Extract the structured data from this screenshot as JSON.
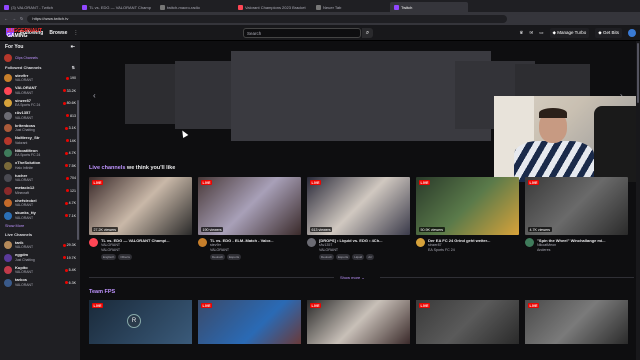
{
  "browser": {
    "tabs": [
      {
        "label": "(3) VALORANT - Twitch",
        "icon": "twitch-icon",
        "active": false
      },
      {
        "label": "TL vs. EDG — VALORANT Champ",
        "icon": "twitch-icon",
        "active": false
      },
      {
        "label": "twitch-macro-radio",
        "icon": "page-icon",
        "active": false
      },
      {
        "label": "Valorant Champions 2023 Bracket",
        "icon": "valorant-icon",
        "active": false
      },
      {
        "label": "Neuer Tab",
        "icon": "page-icon",
        "active": false
      },
      {
        "label": "Twitch",
        "icon": "twitch-icon",
        "active": true
      }
    ],
    "url": "https://www.twitch.tv"
  },
  "topnav": {
    "following": "Following",
    "browse": "Browse",
    "search_placeholder": "Search",
    "manage_turbo": "Manage Turbo",
    "get_bits": "Get Bits"
  },
  "overlay": {
    "line1": "JUGGERNAUT",
    "line2": "GAMING"
  },
  "sidebar": {
    "for_you": "For You",
    "recommended": "Clips Channels",
    "followed_title": "Followed Channels",
    "channels": [
      {
        "name": "stev9rr",
        "game": "VALORANT",
        "viewers": "190",
        "color": "#c77f2b"
      },
      {
        "name": "VALORANT",
        "game": "VALORANT",
        "viewers": "33.2K",
        "color": "#ff4655"
      },
      {
        "name": "sinzer87",
        "game": "EA Sports FC 24",
        "viewers": "80.6K",
        "color": "#d6a23b"
      },
      {
        "name": "rAv1357",
        "game": "VALORANT",
        "viewers": "813",
        "color": "#6b6b73"
      },
      {
        "name": "kritenboss",
        "game": "Just Chatting",
        "viewers": "3.1K",
        "color": "#aa5a3a"
      },
      {
        "name": "NoMercy_Str",
        "game": "Valorant",
        "viewers": "14K",
        "color": "#b5372b"
      },
      {
        "name": "NikoatMeon",
        "game": "EA Sports FC 24",
        "viewers": "4.7K",
        "color": "#3f7b5b"
      },
      {
        "name": "xTheSolution",
        "game": "Halo Infinite",
        "viewers": "7.5K",
        "color": "#7a6a3a"
      },
      {
        "name": "tucher",
        "game": "VALORANT",
        "viewers": "704",
        "color": "#4a4a52"
      },
      {
        "name": "metacix12",
        "game": "Minecraft",
        "viewers": "121",
        "color": "#8a2a2a"
      },
      {
        "name": "chefstrobel",
        "game": "VALORANT",
        "viewers": "4.7K",
        "color": "#c46a2a"
      },
      {
        "name": "skunks_tty",
        "game": "VALORANT",
        "viewers": "7.1K",
        "color": "#2b6fb5"
      }
    ],
    "show_more": "Show More",
    "live_title": "Live Channels",
    "live": [
      {
        "name": "tarik",
        "game": "VALORANT",
        "viewers": "29.3K",
        "color": "#b58a5a"
      },
      {
        "name": "eggdm",
        "game": "Just Chatting",
        "viewers": "19.7K",
        "color": "#5a3a9a"
      },
      {
        "name": "Kupito",
        "game": "VALORANT",
        "viewers": "5.4K",
        "color": "#c13a4a"
      },
      {
        "name": "tarkos",
        "game": "VALORANT",
        "viewers": "6.3K",
        "color": "#3a5a8a"
      }
    ]
  },
  "main": {
    "live_section_prefix": "Live channels",
    "live_section_suffix": "we think you'll like",
    "cards": [
      {
        "title": "TL vs. EDG — VALORANT Champi...",
        "channel": "VALORANT",
        "game": "VALORANT",
        "viewers": "27.2K viewers",
        "tags": [
          "Englisch",
          "Olberts"
        ],
        "thumb": "linear-gradient(135deg,#3a2a2a,#c9b8a8 50%,#2a2a2a)",
        "avatar": "#ff4655"
      },
      {
        "title": "TL vs. EDG - ELM..Match - Valor...",
        "channel": "stev9rr",
        "game": "VALORANT",
        "viewers": "190 viewers",
        "tags": [
          "Deutsch",
          "Esports"
        ],
        "thumb": "linear-gradient(135deg,#4a3a3a,#a8a0b8 50%,#3a2a2a)",
        "avatar": "#c77f2b"
      },
      {
        "title": "[DROPS] • Liquid vs. EDG • 4Ch...",
        "channel": "rAv1357",
        "game": "VALORANT",
        "viewers": "613 viewers",
        "tags": [
          "Deutsch",
          "Esports",
          "Liquid",
          "Arr"
        ],
        "thumb": "linear-gradient(135deg,#2a2a3a,#d0c8c0 50%,#3a3a4a)",
        "avatar": "#6b6b73"
      },
      {
        "title": "Der EA FC 24 Grind geht weiter...",
        "channel": "sinzer87",
        "game": "EA Sports FC 24",
        "viewers": "50.9K viewers",
        "tags": [],
        "thumb": "linear-gradient(135deg,#2a3a2a,#5a7a4a 50%,#d8a23a)",
        "avatar": "#d6a23b"
      },
      {
        "title": "\"Spin the Wheel\" Winchallange mi...",
        "channel": "NikoatMeon",
        "game": "Anderes",
        "viewers": "4.7K viewers",
        "tags": [],
        "thumb": "linear-gradient(135deg,#3a3a3a,#6a6a6a 50%,#2a2a2a)",
        "avatar": "#3f7b5b"
      }
    ],
    "show_more": "Show more",
    "second_section": "Team FPS"
  }
}
